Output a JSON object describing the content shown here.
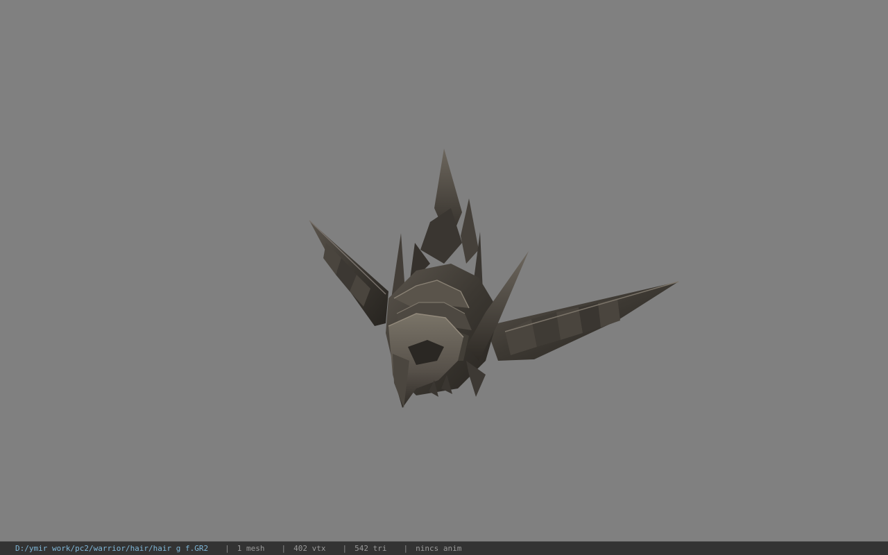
{
  "viewer": {
    "background_color": "#808080",
    "model_name": "helmet-model"
  },
  "statusbar": {
    "file_path": "D:/ymir work/pc2/warrior/hair/hair g f.GR2",
    "separator": "|",
    "mesh_count": "1 mesh",
    "vertex_count": "402 vtx",
    "triangle_count": "542 tri",
    "animation": "nincs anim",
    "path_color": "#7fb7d8",
    "bg_color": "#333333"
  }
}
